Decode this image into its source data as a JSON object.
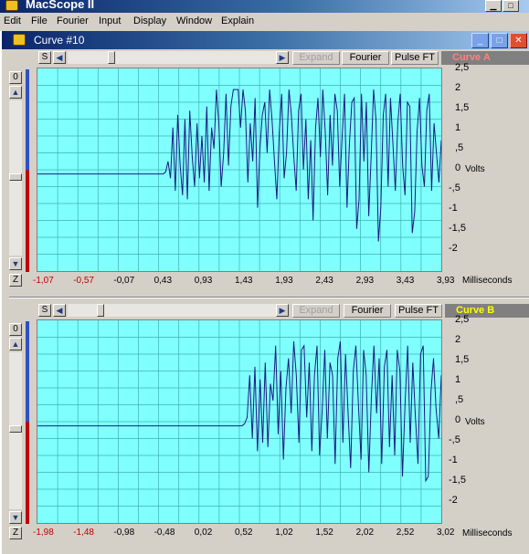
{
  "app": {
    "title": "MacScope II"
  },
  "menu": [
    "Edit",
    "File",
    "Fourier",
    "Input",
    "Display",
    "Window",
    "Explain"
  ],
  "window": {
    "title": "Curve #10"
  },
  "toolbar": {
    "s_label": "S",
    "expand": "Expand",
    "fourier": "Fourier",
    "pulse_ft": "Pulse FT"
  },
  "side_buttons": {
    "zero": "0",
    "zoom": "Z"
  },
  "units": {
    "y": "Volts",
    "x": "Milliseconds"
  },
  "colors": {
    "curve_a": "#ff8080",
    "curve_b": "#ffff00",
    "plot_bg": "#80ffff",
    "trace": "#1a1a80",
    "grid": "#3fb0b0"
  },
  "panels": [
    {
      "curve_label": "Curve A",
      "y_ticks": [
        "2,5",
        "2",
        "1,5",
        "1",
        ",5",
        "0",
        "-,5",
        "-1",
        "-1,5",
        "-2"
      ],
      "x_ticks": [
        "-1,07",
        "-0,57",
        "-0,07",
        "0,43",
        "0,93",
        "1,43",
        "1,93",
        "2,43",
        "2,93",
        "3,43",
        "3,93"
      ]
    },
    {
      "curve_label": "Curve B",
      "y_ticks": [
        "2,5",
        "2",
        "1,5",
        "1",
        ",5",
        "0",
        "-,5",
        "-1",
        "-1,5",
        "-2"
      ],
      "x_ticks": [
        "-1,98",
        "-1,48",
        "-0,98",
        "-0,48",
        "0,02",
        "0,52",
        "1,02",
        "1,52",
        "2,02",
        "2,52",
        "3,02"
      ]
    }
  ],
  "chart_data": [
    {
      "type": "line",
      "series": [
        {
          "x_start": -1.07,
          "x_end": 3.93,
          "onset": 0.0,
          "values": [
            0,
            0,
            0,
            0,
            0,
            0,
            0,
            0,
            0,
            0,
            0,
            0,
            0,
            0,
            0,
            0,
            0,
            0,
            0,
            0,
            0,
            0,
            0,
            0,
            0,
            0,
            0,
            0,
            0,
            0,
            0,
            0,
            0,
            0,
            0,
            0,
            0,
            0,
            0,
            0,
            0,
            0,
            0,
            0,
            0,
            0,
            0,
            0,
            0,
            0,
            0,
            0,
            0,
            0.05,
            0.3,
            -0.1,
            1.1,
            -0.4,
            1.4,
            0.2,
            -0.5,
            1.3,
            -0.6,
            1.5,
            0.4,
            -0.3,
            1.2,
            -0.1,
            0.9,
            -0.2,
            1.6,
            -0.4,
            1.1,
            0.6,
            2.0,
            1.2,
            -0.3,
            0.5,
            1.9,
            0.2,
            1.6,
            2.0,
            2.0,
            2.0,
            1.1,
            2.0,
            1.5,
            -0.2,
            1.2,
            0.3,
            1.8,
            -0.8,
            0.6,
            1.4,
            1.7,
            0.5,
            2.0,
            1.3,
            0.3,
            -0.6,
            1.0,
            1.9,
            -0.1,
            0.5,
            2.0,
            1.4,
            0.4,
            -0.4,
            1.5,
            1.9,
            0.1,
            1.3,
            -0.6,
            0.8,
            -1.1,
            1.1,
            1.8,
            0.4,
            2.0,
            1.0,
            -0.5,
            1.4,
            0.2,
            1.9,
            1.5,
            -0.3,
            0.9,
            1.9,
            -0.8,
            0.7,
            1.7,
            1.8,
            -1.3,
            -0.6,
            1.9,
            0.3,
            1.7,
            -1.0,
            0.4,
            2.0,
            1.3,
            -1.6,
            -0.8,
            1.4,
            1.9,
            -0.3,
            1.8,
            0.7,
            -0.4,
            1.2,
            1.9,
            0.2,
            -0.5,
            1.7,
            1.6,
            -1.4,
            -0.9,
            1.0,
            1.8,
            0.2,
            -0.3,
            1.5,
            1.9,
            -0.4,
            1.2,
            0.5,
            -0.2,
            0.8
          ]
        }
      ],
      "xlabel": "Milliseconds",
      "ylabel": "Volts",
      "xlim": [
        -1.07,
        3.93
      ],
      "ylim": [
        -2.3,
        2.5
      ]
    },
    {
      "type": "line",
      "series": [
        {
          "x_start": -1.98,
          "x_end": 3.02,
          "values": [
            0,
            0,
            0,
            0,
            0,
            0,
            0,
            0,
            0,
            0,
            0,
            0,
            0,
            0,
            0,
            0,
            0,
            0,
            0,
            0,
            0,
            0,
            0,
            0,
            0,
            0,
            0,
            0,
            0,
            0,
            0,
            0,
            0,
            0,
            0,
            0,
            0,
            0,
            0,
            0,
            0,
            0,
            0,
            0,
            0,
            0,
            0,
            0,
            0,
            0,
            0,
            0,
            0,
            0,
            0,
            0,
            0,
            0,
            0,
            0,
            0,
            0,
            0,
            0,
            0,
            0,
            0,
            0,
            0,
            0,
            0,
            0,
            0,
            0,
            0,
            0,
            0,
            0,
            0,
            0,
            0.05,
            0.2,
            1.2,
            -0.3,
            1.4,
            -0.6,
            1.1,
            -0.4,
            1.5,
            -0.5,
            1.0,
            0.6,
            1.9,
            -0.2,
            1.3,
            -0.8,
            0.9,
            1.6,
            0.3,
            2.0,
            1.2,
            -0.4,
            1.8,
            1.9,
            0.2,
            1.5,
            -0.6,
            1.2,
            1.9,
            -0.7,
            0.4,
            1.8,
            -0.3,
            1.5,
            1.2,
            -0.9,
            1.6,
            2.0,
            -0.4,
            1.7,
            0.3,
            -1.0,
            1.3,
            1.9,
            0.5,
            -0.8,
            1.8,
            1.2,
            -1.1,
            0.7,
            1.9,
            0.3,
            1.6,
            -0.9,
            1.4,
            1.8,
            -0.5,
            1.2,
            -0.7,
            1.8,
            1.3,
            -1.2,
            0.5,
            1.9,
            -0.4,
            1.5,
            0.2,
            -0.9,
            1.7,
            1.9,
            -1.3,
            -1.2,
            0.8,
            1.6,
            0.4,
            -0.3,
            1.2
          ]
        }
      ],
      "xlabel": "Milliseconds",
      "ylabel": "Volts",
      "xlim": [
        -1.98,
        3.02
      ],
      "ylim": [
        -2.3,
        2.5
      ]
    }
  ]
}
